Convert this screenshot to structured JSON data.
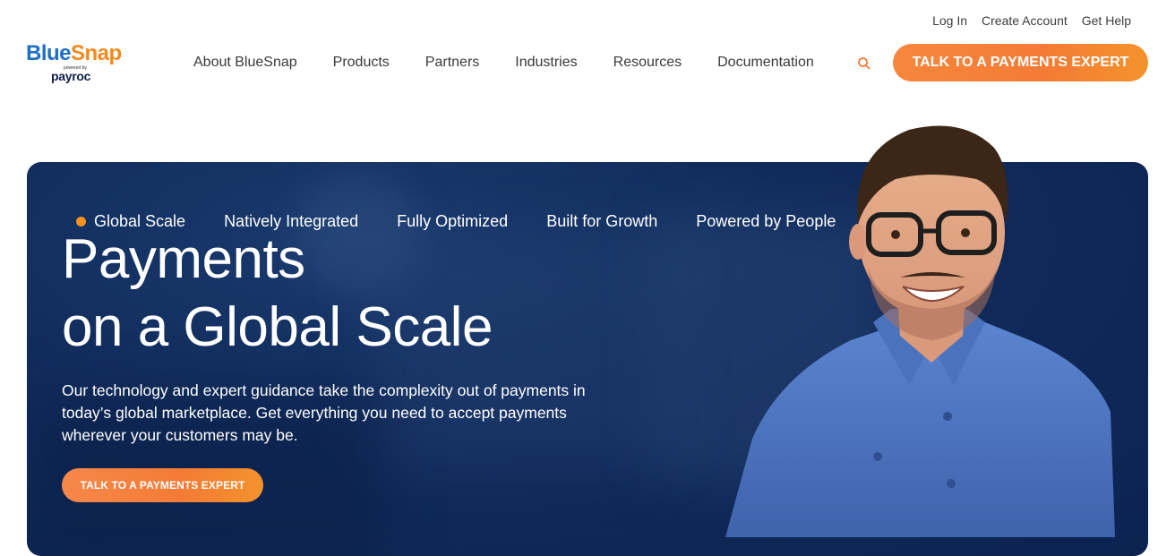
{
  "utility_nav": {
    "login": "Log In",
    "create_account": "Create Account",
    "get_help": "Get Help"
  },
  "logo": {
    "blue_part": "Blue",
    "orange_part": "Snap",
    "powered_by": "powered by",
    "payroc": "payroc"
  },
  "main_nav": {
    "items": [
      "About BlueSnap",
      "Products",
      "Partners",
      "Industries",
      "Resources",
      "Documentation"
    ]
  },
  "header_cta": "TALK TO A PAYMENTS EXPERT",
  "hero": {
    "tabs": [
      "Global Scale",
      "Natively Integrated",
      "Fully Optimized",
      "Built for Growth",
      "Powered by People"
    ],
    "active_tab": "Global Scale",
    "title_line1": "Payments",
    "title_line2": "on a Global Scale",
    "description": "Our technology and expert guidance take the complexity out of payments in today’s global marketplace. Get everything you need to accept payments wherever your customers may be.",
    "cta": "TALK TO A PAYMENTS EXPERT"
  },
  "colors": {
    "accent_orange": "#f47b35",
    "hero_navy": "#112c5c",
    "brand_blue": "#1f6fc4"
  },
  "icons": {
    "search": "search-icon"
  }
}
